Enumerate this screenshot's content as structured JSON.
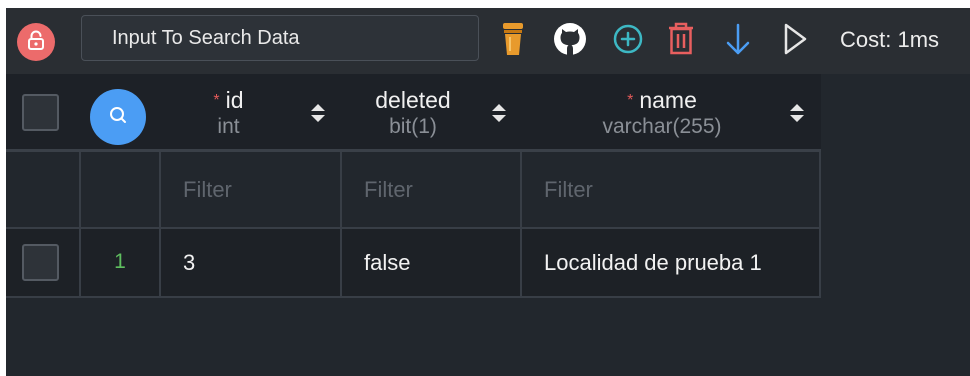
{
  "toolbar": {
    "search_placeholder": "Input To Search Data",
    "cost_label": "Cost: 1ms"
  },
  "colors": {
    "lock_button": "#ec6b6b",
    "search_button": "#4b9df4",
    "required_marker": "#e35a5a",
    "row_number": "#5fbf5f",
    "beer_icon": "#e89a2c",
    "add_icon": "#3db8c4",
    "delete_icon": "#e85f5f",
    "download_icon": "#4b9df4"
  },
  "icons": [
    "unlock-icon",
    "beer-icon",
    "github-icon",
    "add-circle-icon",
    "trash-icon",
    "arrow-down-icon",
    "play-icon",
    "search-icon",
    "sort-icon"
  ],
  "table": {
    "columns": [
      {
        "name": "id",
        "type": "int",
        "required": true,
        "required_mark": "*"
      },
      {
        "name": "deleted",
        "type": "bit(1)",
        "required": false
      },
      {
        "name": "name",
        "type": "varchar(255)",
        "required": true,
        "required_mark": "*"
      }
    ],
    "filter_placeholder": "Filter",
    "rows": [
      {
        "row_number": "1",
        "cells": [
          "3",
          "false",
          "Localidad de prueba 1"
        ]
      }
    ]
  }
}
